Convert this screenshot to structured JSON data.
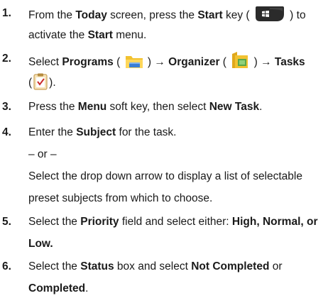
{
  "steps": [
    {
      "number": "1.",
      "line1": [
        "From the ",
        "Today",
        " screen, press the ",
        "Start",
        " key ( ",
        " ) to"
      ],
      "line2": [
        "activate the ",
        "Start",
        " menu."
      ],
      "icons": [
        "windows-start-key-icon"
      ]
    },
    {
      "number": "2.",
      "line1": [
        "Select ",
        "Programs",
        " ( ",
        " ) ",
        "→",
        " ",
        "Organizer",
        " ( ",
        " ) ",
        "→",
        " ",
        "Tasks"
      ],
      "line2": [
        "(",
        ")."
      ],
      "icons": [
        "programs-folder-icon",
        "organizer-folder-icon",
        "tasks-clipboard-icon"
      ]
    },
    {
      "number": "3.",
      "line1": [
        "Press the ",
        "Menu",
        " soft key, then select ",
        "New Task",
        "."
      ]
    },
    {
      "number": "4.",
      "line1": [
        "Enter the ",
        "Subject",
        " for the task."
      ],
      "or": "– or –",
      "line2": "Select the drop down arrow to display a list of selectable",
      "line3": "preset subjects from which to choose."
    },
    {
      "number": "5.",
      "line1": [
        "Select the ",
        "Priority",
        " field and select either: ",
        "High, Normal, or"
      ],
      "line2": "Low."
    },
    {
      "number": "6.",
      "line1": [
        "Select the ",
        "Status",
        " box and select ",
        "Not Completed",
        " or"
      ],
      "line2": [
        "Completed",
        "."
      ]
    }
  ],
  "colors": {
    "text": "#1a1a1a",
    "start_key_bg": "#2b2b2b",
    "folder_yellow": "#f2c230",
    "folder_blue": "#3a7fd5",
    "organizer_green": "#5aa84a",
    "clipboard_border": "#c9a15a"
  }
}
